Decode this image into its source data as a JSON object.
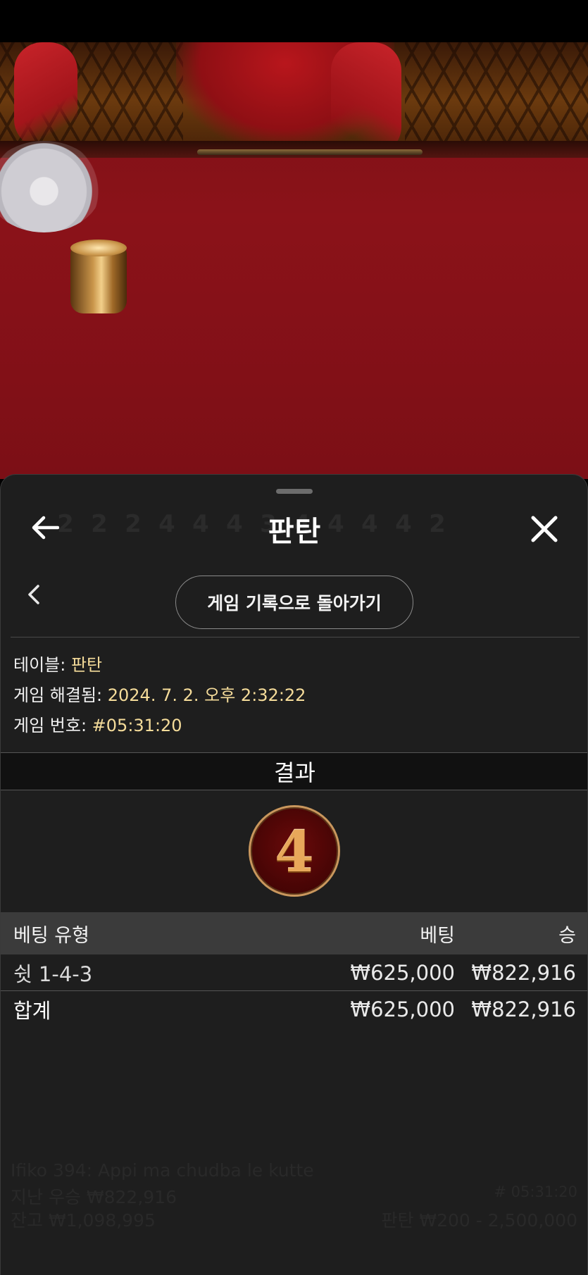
{
  "sheet": {
    "title": "판탄",
    "history_button": "게임 기록으로 돌아가기"
  },
  "info": {
    "table_label": "테이블: ",
    "table_value": "판탄",
    "resolved_label": "게임 해결됨: ",
    "resolved_value": "2024. 7. 2. 오후 2:32:22",
    "game_no_label": "게임 번호: ",
    "game_no_value": "#05:31:20"
  },
  "result": {
    "header": "결과",
    "number": "4"
  },
  "bets": {
    "headers": {
      "type": "베팅 유형",
      "bet": "베팅",
      "win": "승"
    },
    "rows": [
      {
        "type": "쉿 1-4-3",
        "bet": "₩625,000",
        "win": "₩822,916"
      }
    ],
    "total": {
      "type": "합계",
      "bet": "₩625,000",
      "win": "₩822,916"
    }
  },
  "background": {
    "bead_road": [
      "2",
      "2",
      "2",
      "4",
      "4",
      "4",
      "3",
      "4",
      "4",
      "4",
      "4",
      "2"
    ],
    "player_line": "Ifiko 394: Appi ma chudba le kutte",
    "last_win": "지난 우승 ₩822,916",
    "balance": "잔고 ₩1,098,995",
    "game_id": "# 05:31:20",
    "limits": "판탄 ₩200 - 2,500,000"
  },
  "icons": {
    "back": "back-arrow-icon",
    "close": "close-icon",
    "chevron": "chevron-left-icon"
  },
  "colors": {
    "accent_gold": "#f5dc9a",
    "sheet_bg": "#1e1e1e",
    "table_felt": "#8b1219"
  }
}
